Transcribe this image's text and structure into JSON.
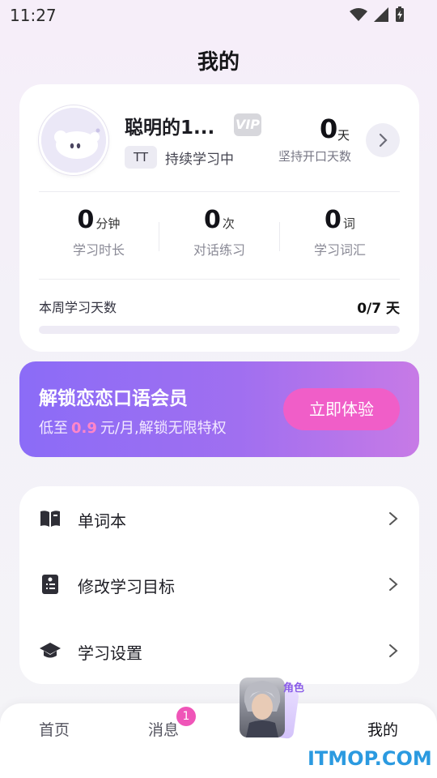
{
  "status_bar": {
    "time": "11:27"
  },
  "page": {
    "title": "我的"
  },
  "profile": {
    "name": "聪明的1...",
    "vip_badge": "VIP",
    "level_badge": "TT",
    "status": "持续学习中",
    "streak_value": "0",
    "streak_unit": "天",
    "streak_label": "坚持开口天数"
  },
  "stats": [
    {
      "value": "0",
      "unit": "分钟",
      "label": "学习时长"
    },
    {
      "value": "0",
      "unit": "次",
      "label": "对话练习"
    },
    {
      "value": "0",
      "unit": "词",
      "label": "学习词汇"
    }
  ],
  "week": {
    "label": "本周学习天数",
    "value": "0/7 天",
    "progress": 0
  },
  "vip_banner": {
    "title": "解锁恋恋口语会员",
    "sub_prefix": "低至",
    "price": "0.9",
    "sub_suffix": "元/月,解锁无限特权",
    "button": "立即体验",
    "colors": {
      "start": "#8b6cf7",
      "end": "#c77ae6",
      "button": "#f05ec8"
    }
  },
  "menu": [
    {
      "label": "单词本",
      "icon": "book-icon"
    },
    {
      "label": "修改学习目标",
      "icon": "clipboard-icon"
    },
    {
      "label": "学习设置",
      "icon": "graduation-cap-icon"
    }
  ],
  "tabbar": {
    "home": "首页",
    "messages": "消息",
    "messages_badge": "1",
    "role": "角色",
    "mine": "我的"
  },
  "watermark": "ITMOP.COM"
}
